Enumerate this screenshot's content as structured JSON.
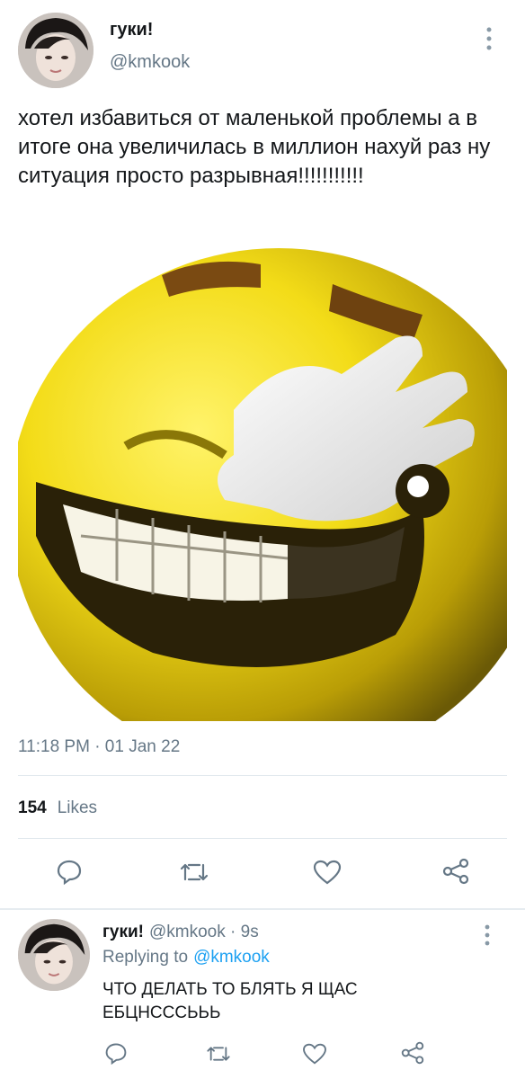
{
  "tweet": {
    "display_name": "гуки!",
    "handle": "@kmkook",
    "text": "хотел избавиться от маленькой проблемы а в итоге она увеличилась в миллион нахуй раз ну ситуация просто разрывная!!!!!!!!!!!",
    "time": "11:18 PM · 01 Jan 22",
    "likes_count": "154",
    "likes_label": "Likes",
    "image_icon": "laughing-emoji-image"
  },
  "actions": [
    "reply-icon",
    "retweet-icon",
    "like-icon",
    "share-icon"
  ],
  "reply": {
    "display_name": "гуки!",
    "handle_time": "@kmkook · 9s",
    "replying_to_prefix": "Replying to",
    "replying_to_handle": "@kmkook",
    "text": "ЧТО ДЕЛАТЬ ТО БЛЯТЬ Я ЩАС ЕБЦНСССЬЬЬ"
  },
  "colors": {
    "link": "#1da1f2",
    "muted": "#657786",
    "text": "#14171a",
    "divider": "#e1e8ed"
  }
}
